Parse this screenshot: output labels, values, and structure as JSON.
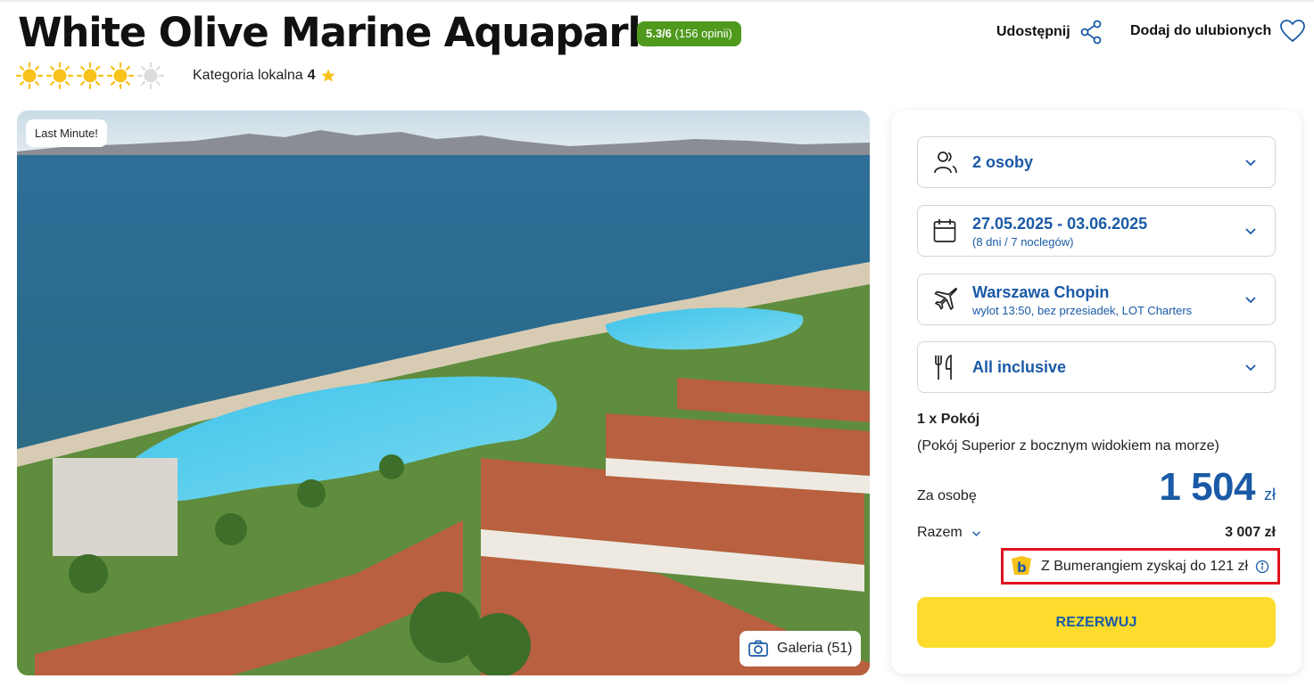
{
  "hotel": {
    "name": "White Olive Marine Aquapark",
    "rating_score": "5.3/6",
    "rating_count": "(156 opinii)",
    "sun_rating": 4,
    "sun_max": 5,
    "local_category_label": "Kategoria lokalna",
    "local_category_value": "4"
  },
  "actions": {
    "share_label": "Udostępnij",
    "favorite_label": "Dodaj do ulubionych"
  },
  "photo": {
    "badge": "Last Minute!",
    "gallery_label": "Galeria (51)"
  },
  "booking": {
    "travellers": "2 osoby",
    "dates": "27.05.2025 - 03.06.2025",
    "dates_sub": "(8 dni / 7 noclegów)",
    "departure": "Warszawa Chopin",
    "departure_sub": "wylot 13:50, bez przesiadek, LOT Charters",
    "board": "All inclusive",
    "room_count": "1 x Pokój",
    "room_type": "(Pokój Superior z bocznym widokiem na morze)",
    "per_person_label": "Za osobę",
    "price_per_person": "1 504",
    "currency": "zł",
    "total_label": "Razem",
    "total_value": "3 007 zł",
    "bumerang_text": "Z Bumerangiem zyskaj do 121 zł",
    "reserve_label": "REZERWUJ"
  },
  "colors": {
    "accent_blue": "#1a5aa6",
    "rating_green": "#4f9a1d",
    "reserve_yellow": "#fddc2e",
    "sun_yellow": "#f7c21a",
    "highlight_red": "#e0121f"
  },
  "icons": [
    "sun-icon",
    "star-icon",
    "share-icon",
    "heart-icon",
    "people-icon",
    "calendar-icon",
    "plane-icon",
    "cutlery-icon",
    "chevron-down-icon",
    "camera-icon",
    "bumerang-logo-icon",
    "info-icon"
  ]
}
